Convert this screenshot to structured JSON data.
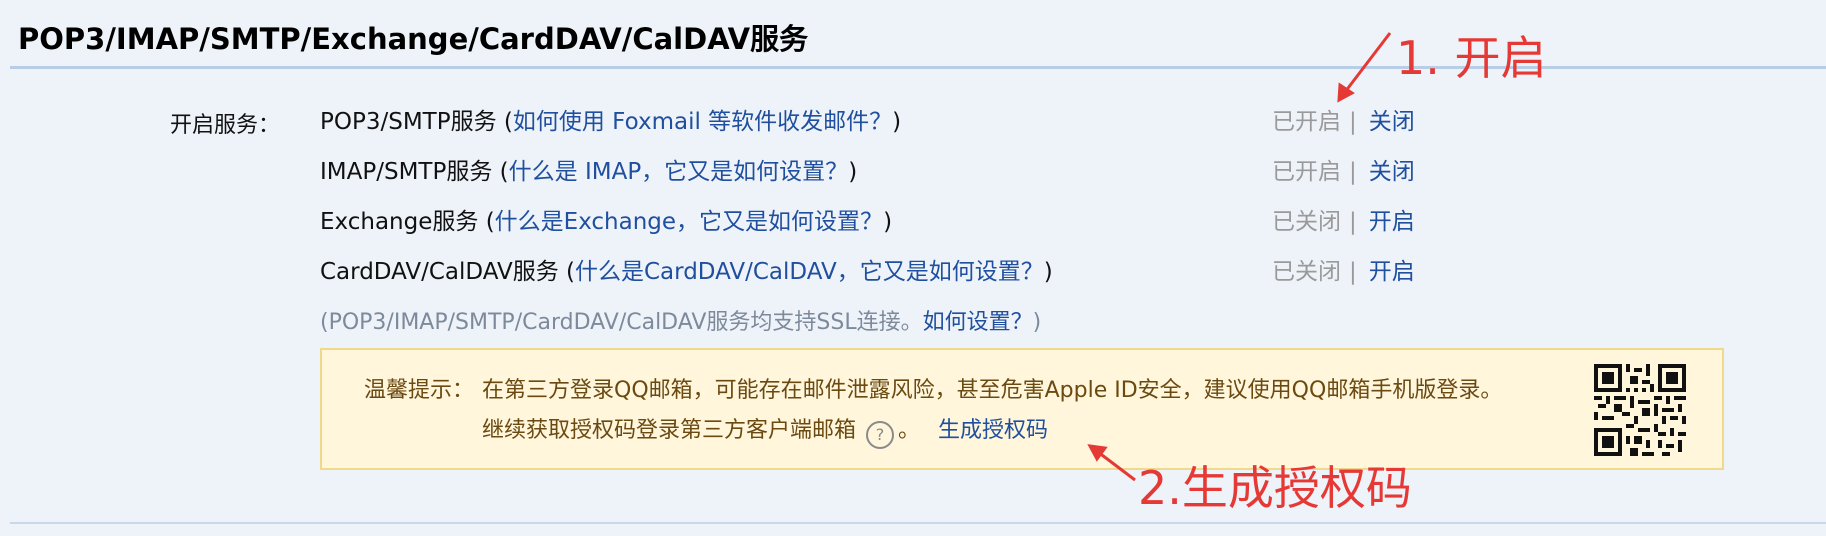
{
  "header": {
    "title": "POP3/IMAP/SMTP/Exchange/CardDAV/CalDAV服务"
  },
  "services": {
    "label": "开启服务：",
    "rows": [
      {
        "name": "POP3/SMTP服务 (",
        "help_link": "如何使用 Foxmail 等软件收发邮件？",
        "close_paren": ")",
        "state": "已开启",
        "action": "关闭"
      },
      {
        "name": "IMAP/SMTP服务 (",
        "help_link": "什么是 IMAP，它又是如何设置？",
        "close_paren": ")",
        "state": "已开启",
        "action": "关闭"
      },
      {
        "name": "Exchange服务 (",
        "help_link": "什么是Exchange，它又是如何设置？",
        "close_paren": ")",
        "state": "已关闭",
        "action": "开启"
      },
      {
        "name": "CardDAV/CalDAV服务 (",
        "help_link": "什么是CardDAV/CalDAV，它又是如何设置？",
        "close_paren": ")",
        "state": "已关闭",
        "action": "开启"
      }
    ],
    "separator": "|",
    "ssl_note": "(POP3/IMAP/SMTP/CardDAV/CalDAV服务均支持SSL连接。",
    "ssl_link": "如何设置？",
    "ssl_close": ")"
  },
  "tip": {
    "label": "温馨提示：",
    "line1": "在第三方登录QQ邮箱，可能存在邮件泄露风险，甚至危害Apple ID安全，建议使用QQ邮箱手机版登录。",
    "line2": "继续获取授权码登录第三方客户端邮箱",
    "help_glyph": "?",
    "period": "。",
    "generate_link": "生成授权码"
  },
  "annotations": {
    "step1": "1. 开启",
    "step2": "2.生成授权码"
  },
  "colors": {
    "link": "#1f4f9e",
    "muted": "#9a9a9a",
    "annotation": "#e53935",
    "tip_bg": "#fff6dc",
    "page_bg": "#eef3f9"
  }
}
